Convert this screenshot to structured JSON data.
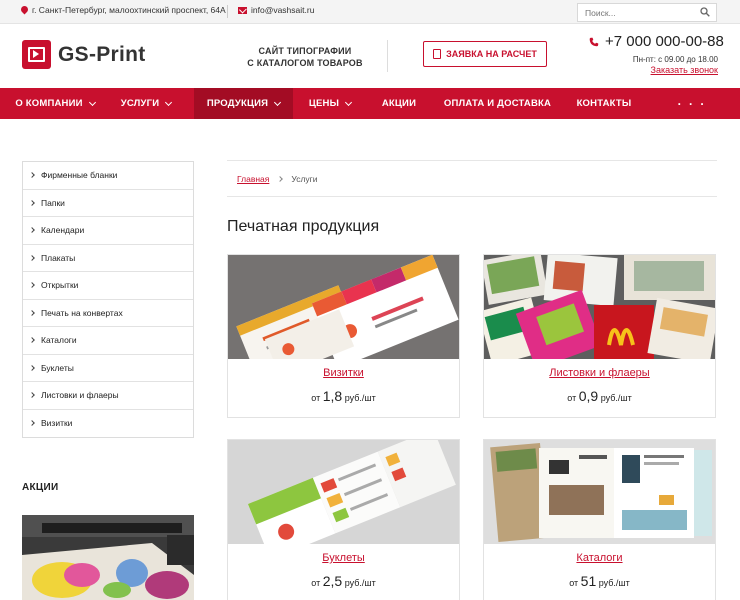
{
  "topbar": {
    "address": "г. Санкт-Петербург, малоохтинский проспект, 64А",
    "email": "info@vashsait.ru",
    "search_placeholder": "Поиск..."
  },
  "header": {
    "logo_text": "GS-Print",
    "slogan_line1": "САЙТ ТИПОГРАФИИ",
    "slogan_line2": "С КАТАЛОГОМ ТОВАРОВ",
    "request_button": "ЗАЯВКА НА РАСЧЕТ",
    "phone": "+7 000 000-00-88",
    "hours": "Пн-пт: с 09.00 до 18.00",
    "callback": "Заказать звонок"
  },
  "nav": {
    "items": [
      {
        "label": "О КОМПАНИИ",
        "dropdown": true
      },
      {
        "label": "УСЛУГИ",
        "dropdown": true
      },
      {
        "label": "ПРОДУКЦИЯ",
        "dropdown": true
      },
      {
        "label": "ЦЕНЫ",
        "dropdown": true
      },
      {
        "label": "АКЦИИ",
        "dropdown": false
      },
      {
        "label": "ОПЛАТА И ДОСТАВКА",
        "dropdown": false
      },
      {
        "label": "КОНТАКТЫ",
        "dropdown": false
      }
    ],
    "more": "· · ·"
  },
  "sidebar": {
    "items": [
      "Фирменные бланки",
      "Папки",
      "Календари",
      "Плакаты",
      "Открытки",
      "Печать на конвертах",
      "Каталоги",
      "Буклеты",
      "Листовки и флаеры",
      "Визитки"
    ],
    "promo_title": "АКЦИИ"
  },
  "breadcrumb": {
    "home": "Главная",
    "current": "Услуги"
  },
  "main": {
    "title": "Печатная продукция",
    "products": [
      {
        "title": "Визитки",
        "price_prefix": "от",
        "price": "1,8",
        "unit": "руб./шт"
      },
      {
        "title": "Листовки и флаеры",
        "price_prefix": "от",
        "price": "0,9",
        "unit": "руб./шт"
      },
      {
        "title": "Буклеты",
        "price_prefix": "от",
        "price": "2,5",
        "unit": "руб./шт"
      },
      {
        "title": "Каталоги",
        "price_prefix": "от",
        "price": "51",
        "unit": "руб./шт"
      }
    ]
  },
  "colors": {
    "brand_red": "#c8102e",
    "nav_active": "#a30c24"
  }
}
